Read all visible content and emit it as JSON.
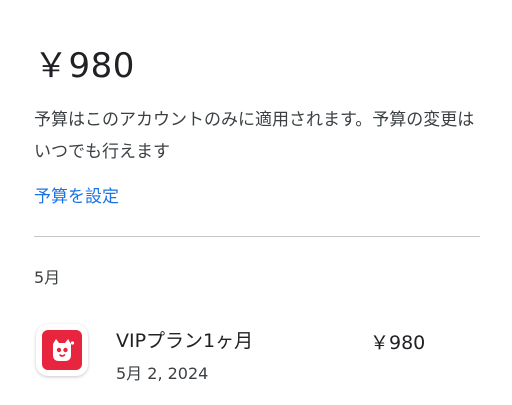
{
  "budget": {
    "amount": "￥980",
    "description": "予算はこのアカウントのみに適用されます。予算の変更はいつでも行えます",
    "set_budget_link": "予算を設定"
  },
  "history": {
    "month_label": "5月",
    "items": [
      {
        "title": "VIPプラン1ヶ月",
        "date": "5月 2, 2024",
        "price": "￥980",
        "icon": "app-logo-icon"
      }
    ]
  },
  "colors": {
    "link": "#1a73e8",
    "app_icon_bg": "#e8253e",
    "divider": "#c4c7c5",
    "text_primary": "#202124",
    "text_secondary": "#3c4043"
  }
}
